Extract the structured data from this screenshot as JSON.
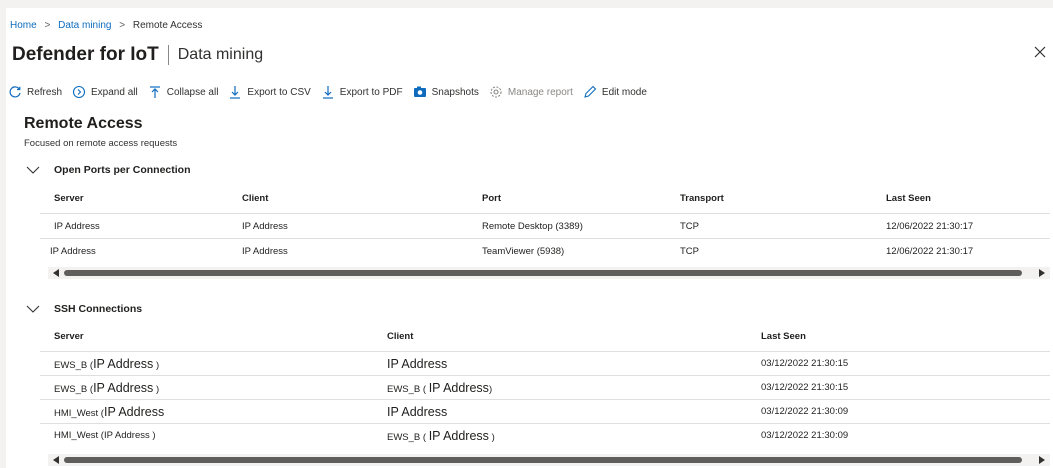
{
  "breadcrumb": {
    "home": "Home",
    "data_mining": "Data mining",
    "current": "Remote Access",
    "sep": ">"
  },
  "header": {
    "title": "Defender for IoT",
    "subtitle": "Data mining",
    "close_icon": "close-icon"
  },
  "toolbar": {
    "refresh": "Refresh",
    "expand_all": "Expand all",
    "collapse_all": "Collapse all",
    "export_csv": "Export to CSV",
    "export_pdf": "Export to PDF",
    "snapshots": "Snapshots",
    "manage_report": "Manage report",
    "edit_mode": "Edit mode"
  },
  "report": {
    "title": "Remote Access",
    "description": "Focused on remote access requests"
  },
  "open_ports": {
    "title": "Open Ports per Connection",
    "columns": [
      "Server",
      "Client",
      "Port",
      "Transport",
      "Last Seen"
    ],
    "rows": [
      {
        "server": "IP Address",
        "client": "IP Address",
        "port": "Remote Desktop (3389)",
        "transport": "TCP",
        "last_seen": "12/06/2022 21:30:17"
      },
      {
        "server": "IP Address",
        "client": "IP Address",
        "port": "TeamViewer (5938)",
        "transport": "TCP",
        "last_seen": "12/06/2022 21:30:17"
      }
    ]
  },
  "ssh": {
    "title": "SSH Connections",
    "columns": [
      "Server",
      "Client",
      "Last Seen"
    ],
    "rows": [
      {
        "server_prefix": "EWS_B (",
        "server_ip": "IP Address",
        "server_suffix": ")",
        "client_prefix": "",
        "client_ip": "IP Address",
        "client_suffix": "",
        "last_seen": "03/12/2022 21:30:15"
      },
      {
        "server_prefix": "EWS_B (",
        "server_ip": "IP Address",
        "server_suffix": ")",
        "client_prefix": "EWS_B (",
        "client_ip": "IP Address",
        "client_suffix": ")",
        "last_seen": "03/12/2022 21:30:15"
      },
      {
        "server_prefix": "HMI_West (",
        "server_ip": "IP Address",
        "server_suffix": "",
        "client_prefix": "",
        "client_ip": "IP Address",
        "client_suffix": "",
        "last_seen": "03/12/2022 21:30:09"
      },
      {
        "server_prefix": "HMI_West (",
        "server_ip": "IP Address",
        "server_suffix": ")",
        "client_prefix": "EWS_B (",
        "client_ip": "IP Address",
        "client_suffix": ")",
        "last_seen": "03/12/2022 21:30:09"
      }
    ]
  },
  "colors": {
    "link": "#0f6cbd",
    "icon": "#0f6cbd",
    "text": "#201f1e",
    "border": "#e1dfdd"
  }
}
